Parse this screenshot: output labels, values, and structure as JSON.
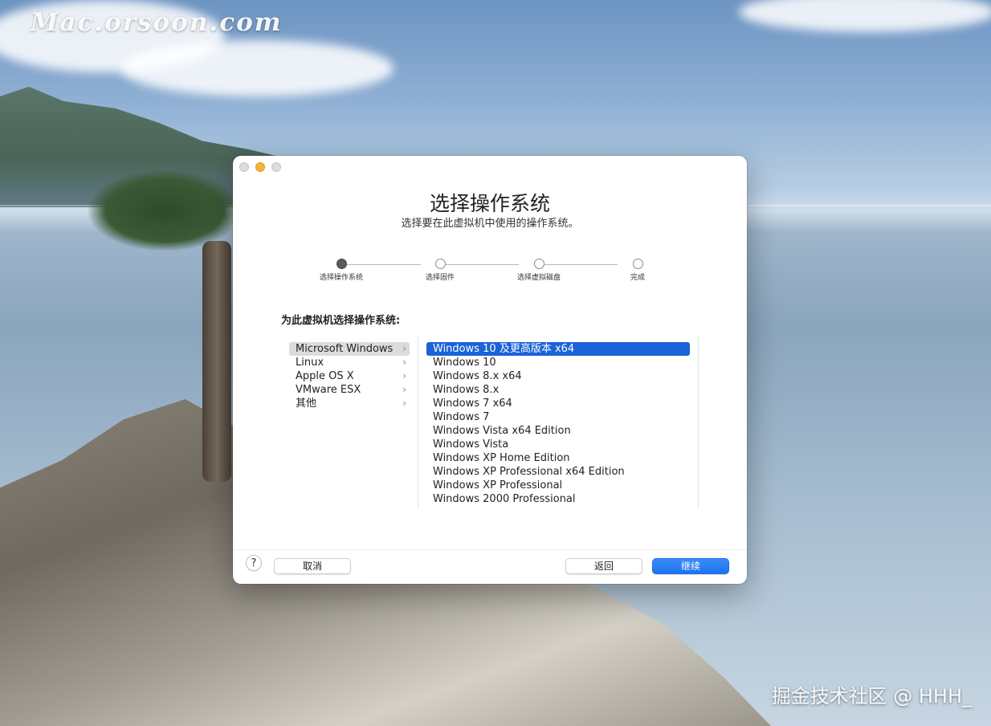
{
  "watermarks": {
    "top_left": "Mac.orsoon.com",
    "bottom_right": "掘金技术社区 @ HHH_"
  },
  "window": {
    "title": "选择操作系统",
    "subtitle": "选择要在此虚拟机中使用的操作系统。",
    "steps": [
      {
        "label": "选择操作系统",
        "state": "active"
      },
      {
        "label": "选择固件",
        "state": "pending"
      },
      {
        "label": "选择虚拟磁盘",
        "state": "pending"
      },
      {
        "label": "完成",
        "state": "pending"
      }
    ],
    "prompt": "为此虚拟机选择操作系统:",
    "categories": [
      {
        "label": "Microsoft Windows",
        "selected": true
      },
      {
        "label": "Linux",
        "selected": false
      },
      {
        "label": "Apple OS X",
        "selected": false
      },
      {
        "label": "VMware ESX",
        "selected": false
      },
      {
        "label": "其他",
        "selected": false
      }
    ],
    "os_options": [
      {
        "label": "Windows 10 及更高版本 x64",
        "selected": true
      },
      {
        "label": "Windows 10",
        "selected": false
      },
      {
        "label": "Windows 8.x x64",
        "selected": false
      },
      {
        "label": "Windows 8.x",
        "selected": false
      },
      {
        "label": "Windows 7 x64",
        "selected": false
      },
      {
        "label": "Windows 7",
        "selected": false
      },
      {
        "label": "Windows Vista x64 Edition",
        "selected": false
      },
      {
        "label": "Windows Vista",
        "selected": false
      },
      {
        "label": "Windows XP Home Edition",
        "selected": false
      },
      {
        "label": "Windows XP Professional x64 Edition",
        "selected": false
      },
      {
        "label": "Windows XP Professional",
        "selected": false
      },
      {
        "label": "Windows 2000 Professional",
        "selected": false
      }
    ],
    "buttons": {
      "help": "?",
      "cancel": "取消",
      "back": "返回",
      "continue": "继续"
    }
  },
  "colors": {
    "accent": "#1a63d8",
    "primary_button": "#1e73f0",
    "minimize_dot": "#f5b33b"
  }
}
